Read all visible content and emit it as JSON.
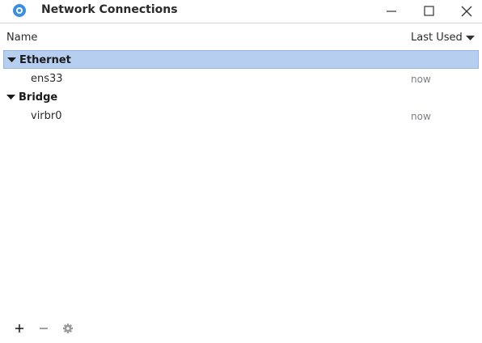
{
  "window": {
    "title": "Network Connections",
    "icons": {
      "app": "network-manager-icon",
      "minimize": "minimize-icon",
      "maximize": "maximize-icon",
      "close": "close-icon"
    }
  },
  "columns": {
    "name": "Name",
    "last_used": "Last Used",
    "sort_icon": "chevron-down-icon"
  },
  "groups": [
    {
      "label": "Ethernet",
      "expanded": true,
      "selected": true,
      "items": [
        {
          "name": "ens33",
          "last_used": "now"
        }
      ]
    },
    {
      "label": "Bridge",
      "expanded": true,
      "selected": false,
      "items": [
        {
          "name": "virbr0",
          "last_used": "now"
        }
      ]
    }
  ],
  "toolbar": {
    "add_icon": "plus-icon",
    "remove_icon": "minus-icon",
    "settings_icon": "gear-icon"
  },
  "colors": {
    "selection": "#b6cff0",
    "accent": "#3c8ede",
    "muted_text": "#7a7f85"
  }
}
